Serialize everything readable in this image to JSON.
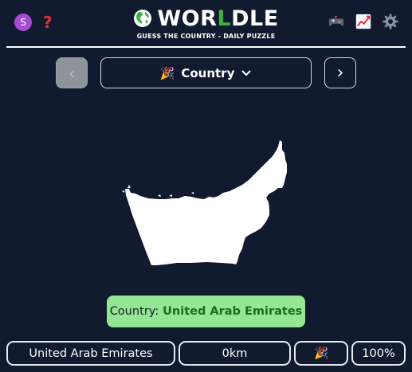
{
  "header": {
    "avatar_letter": "S",
    "help_icon": "question-mark-icon",
    "logo": {
      "part1": "WOR",
      "highlight": "L",
      "part2": "DLE"
    },
    "subtitle": "GUESS THE COUNTRY - DAILY PUZZLE",
    "right_icons": [
      "gamepad-icon",
      "stats-chart-icon",
      "gear-icon"
    ]
  },
  "nav": {
    "mode_emoji": "🎉",
    "mode_label": "Country",
    "prev_arrow": "‹",
    "next_arrow": "›"
  },
  "answer": {
    "prefix": "Country:",
    "country": "United Arab Emirates"
  },
  "guess": {
    "name": "United Arab Emirates",
    "distance": "0km",
    "direction_emoji": "🎉",
    "proximity": "100%"
  },
  "colors": {
    "background": "#111a2e",
    "answer_bg": "#93e694",
    "answer_country": "#1d6b1f",
    "logo_accent": "#3cb043"
  }
}
